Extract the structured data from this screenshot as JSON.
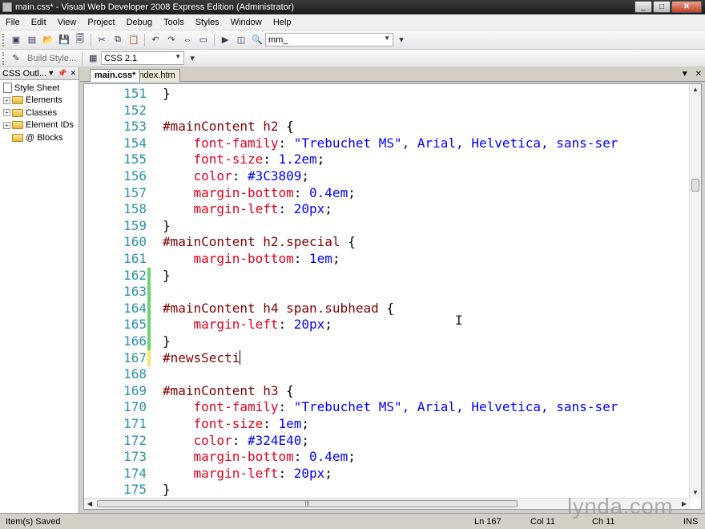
{
  "window": {
    "title": "main.css* - Visual Web Developer 2008 Express Edition (Administrator)"
  },
  "window_controls": {
    "minimize": "_",
    "maximize": "□",
    "close": "✕"
  },
  "menu": [
    "File",
    "Edit",
    "View",
    "Project",
    "Debug",
    "Tools",
    "Styles",
    "Window",
    "Help"
  ],
  "toolbar": {
    "find_combo_value": "mm_",
    "build_style_label": "Build Style...",
    "css_version_value": "CSS 2.1"
  },
  "css_outline": {
    "title": "CSS Outl...",
    "items": [
      {
        "label": "Style Sheet",
        "type": "sheet"
      },
      {
        "label": "Elements",
        "type": "folder"
      },
      {
        "label": "Classes",
        "type": "folder"
      },
      {
        "label": "Element IDs",
        "type": "folder"
      },
      {
        "label": "@ Blocks",
        "type": "folder"
      }
    ]
  },
  "tabs": [
    {
      "label": "main.css*",
      "active": true
    },
    {
      "label": "index.htm",
      "active": false
    }
  ],
  "code_lines": [
    {
      "n": "151",
      "tokens": [
        {
          "t": "}",
          "c": "punc"
        }
      ]
    },
    {
      "n": "152",
      "tokens": []
    },
    {
      "n": "153",
      "tokens": [
        {
          "t": "#mainContent h2",
          "c": "sel"
        },
        {
          "t": " {",
          "c": "punc"
        }
      ]
    },
    {
      "n": "154",
      "tokens": [
        {
          "t": "    font-family",
          "c": "prop"
        },
        {
          "t": ": ",
          "c": "punc"
        },
        {
          "t": "\"Trebuchet MS\", Arial, Helvetica, sans-ser",
          "c": "val"
        }
      ]
    },
    {
      "n": "155",
      "tokens": [
        {
          "t": "    font-size",
          "c": "prop"
        },
        {
          "t": ": ",
          "c": "punc"
        },
        {
          "t": "1.2em",
          "c": "val"
        },
        {
          "t": ";",
          "c": "punc"
        }
      ]
    },
    {
      "n": "156",
      "tokens": [
        {
          "t": "    color",
          "c": "prop"
        },
        {
          "t": ": ",
          "c": "punc"
        },
        {
          "t": "#3C3809",
          "c": "val"
        },
        {
          "t": ";",
          "c": "punc"
        }
      ]
    },
    {
      "n": "157",
      "tokens": [
        {
          "t": "    margin-bottom",
          "c": "prop"
        },
        {
          "t": ": ",
          "c": "punc"
        },
        {
          "t": "0.4em",
          "c": "val"
        },
        {
          "t": ";",
          "c": "punc"
        }
      ]
    },
    {
      "n": "158",
      "tokens": [
        {
          "t": "    margin-left",
          "c": "prop"
        },
        {
          "t": ": ",
          "c": "punc"
        },
        {
          "t": "20px",
          "c": "val"
        },
        {
          "t": ";",
          "c": "punc"
        }
      ]
    },
    {
      "n": "159",
      "tokens": [
        {
          "t": "}",
          "c": "punc"
        }
      ]
    },
    {
      "n": "160",
      "tokens": [
        {
          "t": "#mainContent h2.special",
          "c": "sel"
        },
        {
          "t": " {",
          "c": "punc"
        }
      ]
    },
    {
      "n": "161",
      "tokens": [
        {
          "t": "    margin-bottom",
          "c": "prop"
        },
        {
          "t": ": ",
          "c": "punc"
        },
        {
          "t": "1em",
          "c": "val"
        },
        {
          "t": ";",
          "c": "punc"
        }
      ]
    },
    {
      "n": "162",
      "tokens": [
        {
          "t": "}",
          "c": "punc"
        }
      ]
    },
    {
      "n": "163",
      "tokens": []
    },
    {
      "n": "164",
      "tokens": [
        {
          "t": "#mainContent h4 span.subhead",
          "c": "sel"
        },
        {
          "t": " {",
          "c": "punc"
        }
      ]
    },
    {
      "n": "165",
      "tokens": [
        {
          "t": "    margin-left",
          "c": "prop"
        },
        {
          "t": ": ",
          "c": "punc"
        },
        {
          "t": "20px",
          "c": "val"
        },
        {
          "t": ";",
          "c": "punc"
        }
      ]
    },
    {
      "n": "166",
      "tokens": [
        {
          "t": "}",
          "c": "punc"
        }
      ]
    },
    {
      "n": "167",
      "tokens": [
        {
          "t": "#newsSecti",
          "c": "sel"
        }
      ],
      "caret": true
    },
    {
      "n": "168",
      "tokens": []
    },
    {
      "n": "169",
      "tokens": [
        {
          "t": "#mainContent h3",
          "c": "sel"
        },
        {
          "t": " {",
          "c": "punc"
        }
      ]
    },
    {
      "n": "170",
      "tokens": [
        {
          "t": "    font-family",
          "c": "prop"
        },
        {
          "t": ": ",
          "c": "punc"
        },
        {
          "t": "\"Trebuchet MS\", Arial, Helvetica, sans-ser",
          "c": "val"
        }
      ]
    },
    {
      "n": "171",
      "tokens": [
        {
          "t": "    font-size",
          "c": "prop"
        },
        {
          "t": ": ",
          "c": "punc"
        },
        {
          "t": "1em",
          "c": "val"
        },
        {
          "t": ";",
          "c": "punc"
        }
      ]
    },
    {
      "n": "172",
      "tokens": [
        {
          "t": "    color",
          "c": "prop"
        },
        {
          "t": ": ",
          "c": "punc"
        },
        {
          "t": "#324E40",
          "c": "val"
        },
        {
          "t": ";",
          "c": "punc"
        }
      ]
    },
    {
      "n": "173",
      "tokens": [
        {
          "t": "    margin-bottom",
          "c": "prop"
        },
        {
          "t": ": ",
          "c": "punc"
        },
        {
          "t": "0.4em",
          "c": "val"
        },
        {
          "t": ";",
          "c": "punc"
        }
      ]
    },
    {
      "n": "174",
      "tokens": [
        {
          "t": "    margin-left",
          "c": "prop"
        },
        {
          "t": ": ",
          "c": "punc"
        },
        {
          "t": "20px",
          "c": "val"
        },
        {
          "t": ";",
          "c": "punc"
        }
      ]
    },
    {
      "n": "175",
      "tokens": [
        {
          "t": "}",
          "c": "punc"
        }
      ]
    }
  ],
  "status": {
    "message": "Item(s) Saved",
    "line": "Ln 167",
    "col": "Col 11",
    "ch": "Ch 11",
    "mode": "INS"
  },
  "watermark": "lynda.com",
  "colors": {
    "selector": "#800000",
    "property": "#e3001b",
    "value": "#0000ff",
    "line_number": "#2b91af",
    "change_saved": "#6cd46c",
    "change_unsaved": "#f3e66b"
  }
}
